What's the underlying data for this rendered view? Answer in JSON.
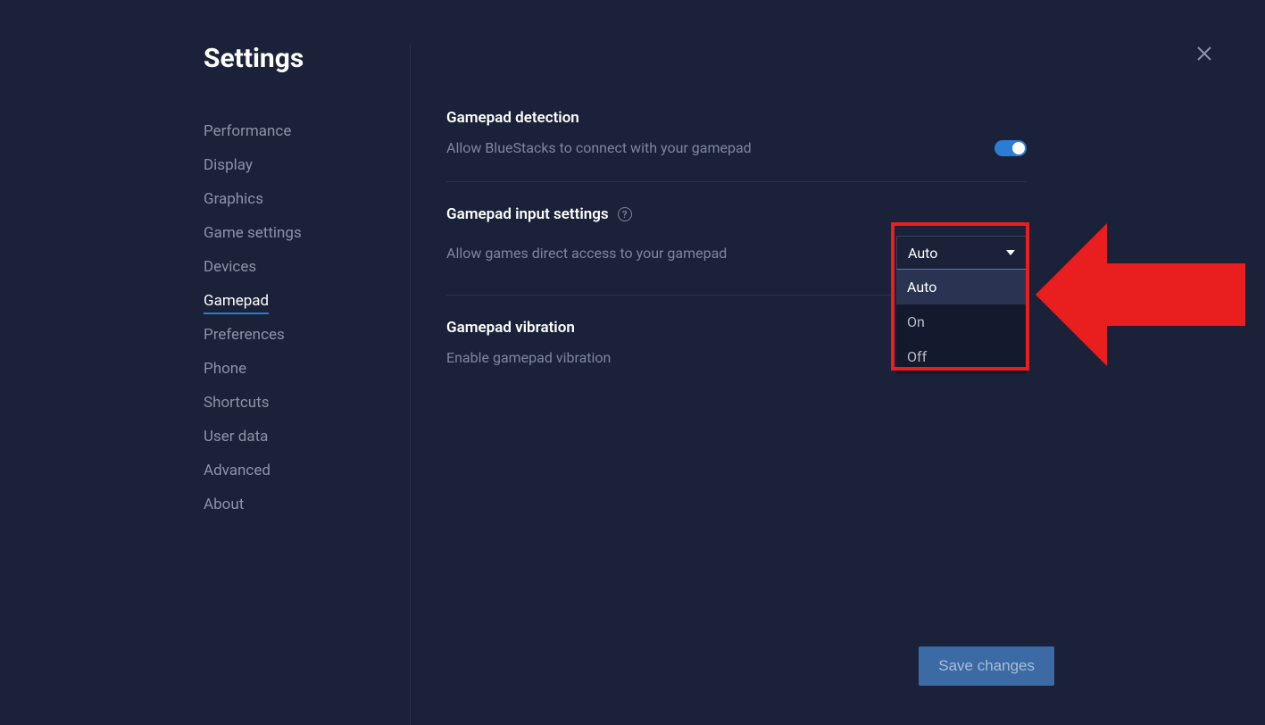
{
  "header": {
    "title": "Settings"
  },
  "sidebar": {
    "items": [
      {
        "label": "Performance"
      },
      {
        "label": "Display"
      },
      {
        "label": "Graphics"
      },
      {
        "label": "Game settings"
      },
      {
        "label": "Devices"
      },
      {
        "label": "Gamepad"
      },
      {
        "label": "Preferences"
      },
      {
        "label": "Phone"
      },
      {
        "label": "Shortcuts"
      },
      {
        "label": "User data"
      },
      {
        "label": "Advanced"
      },
      {
        "label": "About"
      }
    ],
    "active_index": 5
  },
  "sections": {
    "detection": {
      "title": "Gamepad detection",
      "description": "Allow BlueStacks to connect with your gamepad"
    },
    "input": {
      "title": "Gamepad input settings",
      "description": "Allow games direct access to your gamepad",
      "dropdown": {
        "selected": "Auto",
        "options": [
          "Auto",
          "On",
          "Off"
        ]
      }
    },
    "vibration": {
      "title": "Gamepad vibration",
      "description": "Enable gamepad vibration"
    }
  },
  "footer": {
    "save_label": "Save changes"
  },
  "annotation": {
    "highlight_color": "#e91e1e"
  }
}
